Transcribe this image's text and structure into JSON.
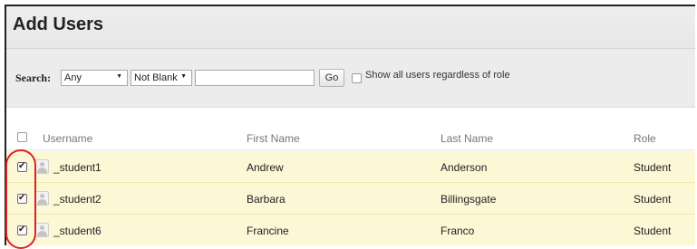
{
  "page_title": "Add Users",
  "search": {
    "label": "Search:",
    "field_select": "Any",
    "operator_select": "Not Blank",
    "query_value": "",
    "go_label": "Go",
    "show_all_label": "Show all users regardless of role",
    "show_all_checked": false
  },
  "table": {
    "headers": {
      "username": "Username",
      "first_name": "First Name",
      "last_name": "Last Name",
      "role": "Role"
    },
    "rows": [
      {
        "username": "_student1",
        "first_name": "Andrew",
        "last_name": "Anderson",
        "role": "Student",
        "checked": true
      },
      {
        "username": "_student2",
        "first_name": "Barbara",
        "last_name": "Billingsgate",
        "role": "Student",
        "checked": true
      },
      {
        "username": "_student6",
        "first_name": "Francine",
        "last_name": "Franco",
        "role": "Student",
        "checked": true
      }
    ]
  },
  "colors": {
    "selected_row": "#fcf7d5",
    "highlight": "#d22222",
    "header_band": "#ececec"
  },
  "icons": {
    "avatar": "user-avatar-icon",
    "check": "checkmark-icon",
    "dropdown": "chevron-down-icon"
  }
}
